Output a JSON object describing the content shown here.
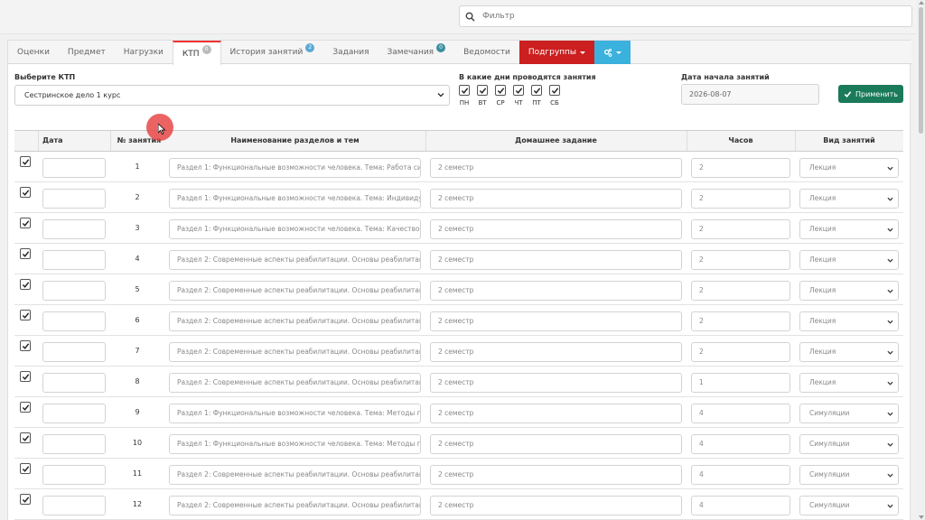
{
  "search": {
    "placeholder": "Фильтр"
  },
  "tabs": [
    {
      "label": "Оценки"
    },
    {
      "label": "Предмет"
    },
    {
      "label": "Нагрузки"
    },
    {
      "label": "КТП",
      "badge": "0"
    },
    {
      "label": "История занятий",
      "badge": "2"
    },
    {
      "label": "Задания"
    },
    {
      "label": "Замечания",
      "badge": "0"
    },
    {
      "label": "Ведомости"
    },
    {
      "label": "Подгруппы"
    }
  ],
  "form": {
    "ktp_label": "Выберите КТП",
    "ktp_value": "Сестринское дело 1 курс",
    "days_label": "В какие дни проводятся занятия",
    "days": [
      "ПН",
      "ВТ",
      "СР",
      "ЧТ",
      "ПТ",
      "СБ"
    ],
    "start_label": "Дата начала занятий",
    "start_value": "2026-08-07",
    "apply_label": "Применить"
  },
  "table": {
    "headers": {
      "date": "Дата",
      "num": "№ занятия",
      "title": "Наименование разделов и тем",
      "homework": "Домашнее задание",
      "hours": "Часов",
      "type": "Вид занятий"
    },
    "rows": [
      {
        "num": "1",
        "title": "Раздел 1: Функциональные возможности человека. Тема: Работа сист",
        "homework": "2 семестр",
        "hours": "2",
        "type": "Лекция"
      },
      {
        "num": "2",
        "title": "Раздел 1: Функциональные возможности человека. Тема: Индивидуа.",
        "homework": "2 семестр",
        "hours": "2",
        "type": "Лекция"
      },
      {
        "num": "3",
        "title": "Раздел 1: Функциональные возможности человека. Тема: Качество ж",
        "homework": "2 семестр",
        "hours": "2",
        "type": "Лекция"
      },
      {
        "num": "4",
        "title": "Раздел 2: Современные аспекты реабилитации. Основы реабилитаци",
        "homework": "2 семестр",
        "hours": "2",
        "type": "Лекция"
      },
      {
        "num": "5",
        "title": "Раздел 2: Современные аспекты реабилитации. Основы реабилитаци",
        "homework": "2 семестр",
        "hours": "2",
        "type": "Лекция"
      },
      {
        "num": "6",
        "title": "Раздел 2: Современные аспекты реабилитации. Основы реабилитаци",
        "homework": "2 семестр",
        "hours": "2",
        "type": "Лекция"
      },
      {
        "num": "7",
        "title": "Раздел 2: Современные аспекты реабилитации. Основы реабилитаци",
        "homework": "2 семестр",
        "hours": "2",
        "type": "Лекция"
      },
      {
        "num": "8",
        "title": "Раздел 2: Современные аспекты реабилитации. Основы реабилитаци",
        "homework": "2 семестр",
        "hours": "1",
        "type": "Лекция"
      },
      {
        "num": "9",
        "title": "Раздел 1: Функциональные возможности человека. Тема: Методы по",
        "homework": "2 семестр",
        "hours": "4",
        "type": "Симуляции"
      },
      {
        "num": "10",
        "title": "Раздел 1: Функциональные возможности человека. Тема: Методы по",
        "homework": "2 семестр",
        "hours": "4",
        "type": "Симуляции"
      },
      {
        "num": "11",
        "title": "Раздел 2: Современные аспекты реабилитации. Основы реабилитаци",
        "homework": "2 семестр",
        "hours": "4",
        "type": "Симуляции"
      },
      {
        "num": "12",
        "title": "Раздел 2: Современные аспекты реабилитации. Основы реабилитаци",
        "homework": "2 семестр",
        "hours": "4",
        "type": "Симуляции"
      }
    ]
  },
  "colors": {
    "active_tab_border": "#e33333",
    "subgroups": "#cc1f1f",
    "settings": "#3bb1dd",
    "apply": "#1a7a5a"
  },
  "icons": {
    "search": "search-icon",
    "settings": "gears-icon",
    "apply": "check-icon"
  }
}
